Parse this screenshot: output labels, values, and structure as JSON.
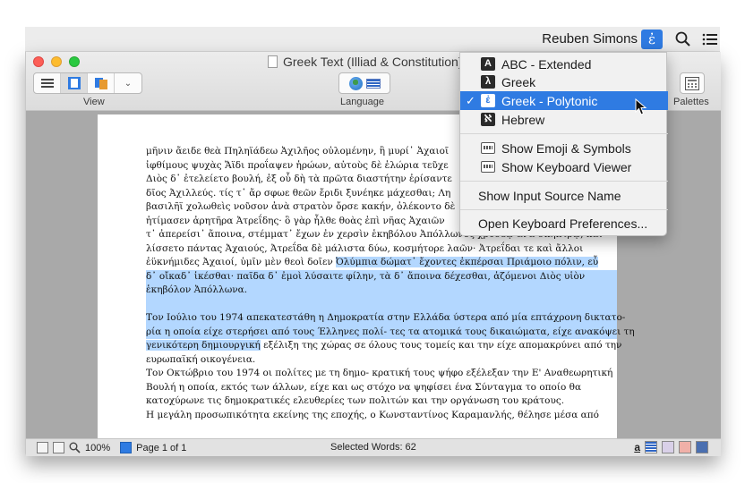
{
  "menubar": {
    "user_name": "Reuben Simons",
    "input_source_glyph": "ἐ"
  },
  "window": {
    "title": "Greek Text (Illiad & Constitution)",
    "toolbar": {
      "view_label": "View",
      "language_label": "Language",
      "palettes_label": "Palettes"
    }
  },
  "document": {
    "lines": [
      "μῆνιν ἄειδε θεὰ Πηληϊάδεω Ἀχιλῆος οὐλομένην, ἣ μυρί᾽ Ἀχαιοῖ",
      "ἰφθίμους ψυχὰς Ἄϊδι προΐαψεν ἡρώων, αὐτοὺς δὲ ἑλώρια τεῦχε",
      "Διὸς δ᾽ ἐτελείετο βουλή, ἐξ οὗ δὴ τὰ πρῶτα διαστήτην ἐρίσαντε",
      "δῖος Ἀχιλλεύς. τίς τ᾽ ἄρ σφωε θεῶν ἔριδι ξυνέηκε μάχεσθαι; Λη",
      "βασιλῆϊ χολωθεὶς νοῦσον ἀνὰ στρατὸν ὄρσε κακήν, ὀλέκοντο δὲ",
      "ἠτίμασεν ἀρητῆρα Ἀτρεΐδης· ὃ γὰρ ἦλθε θοὰς ἐπὶ νῆας Ἀχαιῶν",
      "τ᾽ ἀπερείσι᾽ ἄποινα, στέμματ᾽ ἔχων ἐν χερσὶν ἑκηβόλου Ἀπόλλωνος χρυσέῳ ἀνὰ σκήπτρῳ, καὶ",
      "λίσσετο πάντας Ἀχαιούς, Ἀτρεΐδα δὲ μάλιστα δύω, κοσμήτορε λαῶν· Ἀτρεΐδαι τε καὶ ἄλλοι",
      "ἐϋκνήμιδες Ἀχαιοί, ὑμῖν μὲν θεοὶ δοῖεν Ὀλύμπια δώματ᾽ ἔχοντες ἐκπέρσαι Πριάμοιο πόλιν, εὖ",
      "δ᾽ οἴκαδ᾽ ἱκέσθαι· παῖδα δ᾽ ἐμοὶ λύσαιτε φίλην, τὰ δ᾽ ἄποινα δέχεσθαι, ἁζόμενοι Διὸς υἱὸν",
      "ἑκηβόλον Ἀπόλλωνα.",
      "Τον Ιούλιο του 1974 απεκατεστάθη η Δημοκρατία στην Ελλάδα ύστερα από μία επτάχρονη δικτατο-",
      "ρία η οποία είχε στερήσει από τους Έλληνες πολί- τες τα ατομικά τους δικαιώματα, είχε ανακόψει τη",
      "γενικότερη δημιουργική εξέλιξη της χώρας σε όλους τους τομείς και την είχε απομακρύνει από την",
      "ευρωπαϊκή οικογένεια.",
      "Τον Οκτώβριο του 1974 οι πολίτες με τη δημο- κρατική τους ψήφο εξέλεξαν την Ε' Αναθεωρητική",
      "Βουλή η οποία, εκτός των άλλων, είχε και ως στόχο να ψηφίσει ένα Σύνταγμα το οποίο θα",
      "κατοχύρωνε τις δημοκρατικές ελευθερίες των πολιτών και την οργάνωση του κράτους.",
      "Η μεγάλη προσωπικότητα εκείνης της εποχής, ο Κωνσταντίνος Καραμανλής, θέλησε μέσα από"
    ],
    "line8_highlight_start": "Ὀλύμπια δώματ᾽ ἔχοντες ἐκπέρσαι Πριάμοιο πόλιν, εὖ",
    "line8_plain_part": "ἐϋκνήμιδες Ἀχαιοί, ὑμῖν μὲν θεοὶ δοῖεν ",
    "line13_highlight_part": "γενικότερη δημιουργική",
    "line13_plain_part": " εξέλιξη της χώρας σε όλους τους τομείς και την είχε απομακρύνει από την"
  },
  "statusbar": {
    "zoom": "100%",
    "page": "Page 1 of 1",
    "selected": "Selected Words: 62",
    "font_glyph": "a"
  },
  "dropdown": {
    "items": [
      {
        "label": "ABC - Extended",
        "badge": "A"
      },
      {
        "label": "Greek",
        "badge": "λ"
      },
      {
        "label": "Greek - Polytonic",
        "badge": "ἐ",
        "check": "✓"
      },
      {
        "label": "Hebrew",
        "badge": "ℵ"
      }
    ],
    "tools": [
      {
        "label": "Show Emoji & Symbols"
      },
      {
        "label": "Show Keyboard Viewer"
      }
    ],
    "show_input_source_name": "Show Input Source Name",
    "open_prefs": "Open Keyboard Preferences..."
  },
  "colors": {
    "accent": "#2f7be2",
    "selection": "#b3d7ff"
  }
}
